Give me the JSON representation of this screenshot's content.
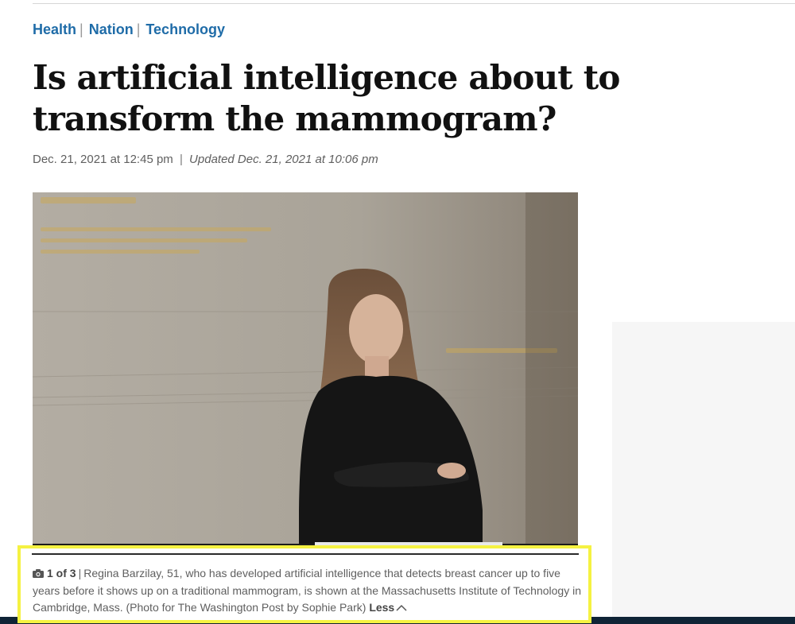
{
  "sections": [
    {
      "label": "Health"
    },
    {
      "label": "Nation"
    },
    {
      "label": "Technology"
    }
  ],
  "headline": "Is artificial intelligence about to transform the mammogram?",
  "dateline": {
    "published": "Dec. 21, 2021 at 12:45 pm",
    "separator": "|",
    "updated": "Updated Dec. 21, 2021 at 10:06 pm"
  },
  "photo": {
    "alt": "Regina Barzilay standing with arms crossed in front of a stone wall"
  },
  "caption": {
    "icon": "camera-icon",
    "counter": "1 of 3",
    "separator": "|",
    "text": "Regina Barzilay, 51, who has developed artificial intelligence that detects breast cancer up to five years before it shows up on a traditional mammogram, is shown at the Massachusetts Institute of Technology in Cambridge, Mass. (Photo for The Washington Post by Sophie Park)",
    "toggle_label": "Less",
    "toggle_icon": "chevron-up-icon"
  },
  "colors": {
    "section_link": "#1f6ca8",
    "highlight": "#f5f242",
    "bottom_band": "#0f2436"
  }
}
